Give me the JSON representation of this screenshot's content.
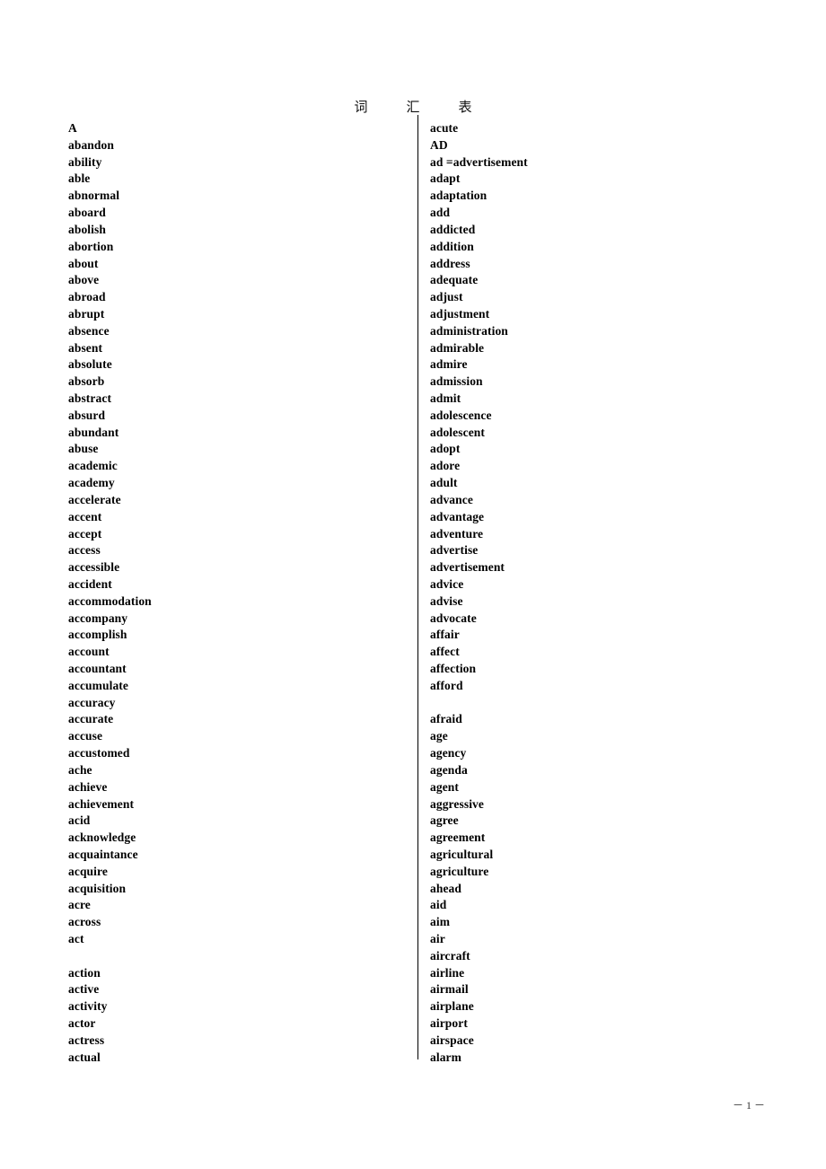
{
  "document": {
    "title": "词　汇　表",
    "page_number": "－ 1 －"
  },
  "columns": {
    "left": [
      "A",
      "abandon",
      "ability",
      "able",
      "abnormal",
      "aboard",
      "abolish",
      "abortion",
      "about",
      "above",
      "abroad",
      "abrupt",
      "absence",
      "absent",
      "absolute",
      "absorb",
      "abstract",
      "absurd",
      "abundant",
      "abuse",
      "academic",
      "academy",
      "accelerate",
      "accent",
      "accept",
      "access",
      "accessible",
      "accident",
      "accommodation",
      "accompany",
      "accomplish",
      "account",
      "accountant",
      "accumulate",
      "accuracy",
      "accurate",
      "accuse",
      "accustomed",
      "ache",
      "achieve",
      "achievement",
      "acid",
      "acknowledge",
      "acquaintance",
      "acquire",
      "acquisition",
      "acre",
      "across",
      "act",
      "",
      "action",
      "active",
      "activity",
      "actor",
      "actress",
      "actual"
    ],
    "right": [
      "acute",
      "AD",
      "ad =advertisement",
      "adapt",
      "adaptation",
      "add",
      "addicted",
      "addition",
      "address",
      "adequate",
      "adjust",
      "adjustment",
      "administration",
      "admirable",
      "admire",
      "admission",
      "admit",
      "adolescence",
      "adolescent",
      "adopt",
      "adore",
      "adult",
      "advance",
      "advantage",
      "adventure",
      "advertise",
      "advertisement",
      "advice",
      "advise",
      "advocate",
      "affair",
      "affect",
      "affection",
      "afford",
      "",
      "afraid",
      "age",
      "agency",
      "agenda",
      "agent",
      "aggressive",
      "agree",
      "agreement",
      "agricultural",
      "agriculture",
      "ahead",
      "aid",
      "aim",
      "air",
      "aircraft",
      "airline",
      "airmail",
      "airplane",
      "airport",
      "airspace",
      "alarm"
    ]
  }
}
